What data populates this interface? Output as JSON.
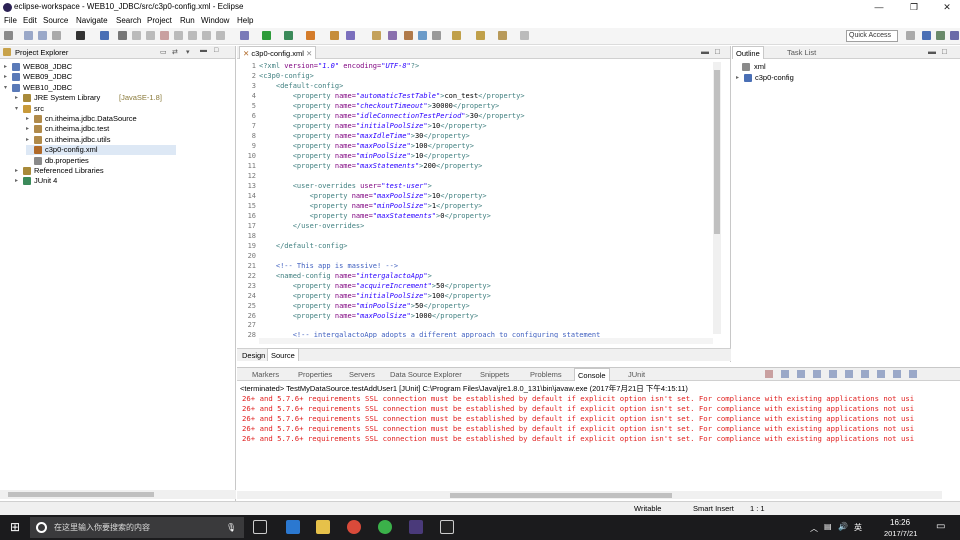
{
  "window": {
    "title": "eclipse-workspace - WEB10_JDBC/src/c3p0-config.xml - Eclipse"
  },
  "menu": [
    "File",
    "Edit",
    "Source",
    "Navigate",
    "Search",
    "Project",
    "Run",
    "Window",
    "Help"
  ],
  "toolbar": {
    "quick_access": "Quick Access"
  },
  "explorer": {
    "title": "Project Explorer",
    "items": [
      {
        "label": "WEB08_JDBC",
        "depth": 0,
        "twisty": "▸"
      },
      {
        "label": "WEB09_JDBC",
        "depth": 0,
        "twisty": "▸"
      },
      {
        "label": "WEB10_JDBC",
        "depth": 0,
        "twisty": "▾"
      },
      {
        "label": "JRE System Library",
        "suffix": "[JavaSE-1.8]",
        "depth": 1,
        "twisty": "▸"
      },
      {
        "label": "src",
        "depth": 1,
        "twisty": "▾"
      },
      {
        "label": "cn.itheima.jdbc.DataSource",
        "depth": 2,
        "twisty": "▸"
      },
      {
        "label": "cn.itheima.jdbc.test",
        "depth": 2,
        "twisty": "▸"
      },
      {
        "label": "cn.itheima.jdbc.utils",
        "depth": 2,
        "twisty": "▸"
      },
      {
        "label": "c3p0-config.xml",
        "depth": 2,
        "twisty": "",
        "selected": true
      },
      {
        "label": "db.properties",
        "depth": 2,
        "twisty": ""
      },
      {
        "label": "Referenced Libraries",
        "depth": 1,
        "twisty": "▸"
      },
      {
        "label": "JUnit 4",
        "depth": 1,
        "twisty": "▸"
      }
    ]
  },
  "editor": {
    "tab": "c3p0-config.xml",
    "bottom_tabs": {
      "design": "Design",
      "source": "Source"
    },
    "line_numbers": [
      "1",
      "2",
      "3",
      "4",
      "5",
      "6",
      "7",
      "8",
      "9",
      "10",
      "11",
      "12",
      "13",
      "14",
      "15",
      "16",
      "17",
      "18",
      "19",
      "20",
      "21",
      "22",
      "23",
      "24",
      "25",
      "26",
      "27",
      "28"
    ],
    "lines": [
      [
        {
          "t": "<?xml ",
          "c": "pi"
        },
        {
          "t": "version=",
          "c": "at"
        },
        {
          "t": "\"1.0\"",
          "c": "av"
        },
        {
          "t": " encoding=",
          "c": "at"
        },
        {
          "t": "\"UTF-8\"",
          "c": "av"
        },
        {
          "t": "?>",
          "c": "pi"
        }
      ],
      [
        {
          "t": "<c3p0-config>",
          "c": "tg"
        }
      ],
      [
        {
          "t": "    <default-config>",
          "c": "tg"
        }
      ],
      [
        {
          "t": "        <property ",
          "c": "tg"
        },
        {
          "t": "name=",
          "c": "at"
        },
        {
          "t": "\"automaticTestTable\"",
          "c": "av"
        },
        {
          "t": ">",
          "c": "tg"
        },
        {
          "t": "con_test",
          "c": "tx"
        },
        {
          "t": "</property>",
          "c": "tg"
        }
      ],
      [
        {
          "t": "        <property ",
          "c": "tg"
        },
        {
          "t": "name=",
          "c": "at"
        },
        {
          "t": "\"checkoutTimeout\"",
          "c": "av"
        },
        {
          "t": ">",
          "c": "tg"
        },
        {
          "t": "30000",
          "c": "tx"
        },
        {
          "t": "</property>",
          "c": "tg"
        }
      ],
      [
        {
          "t": "        <property ",
          "c": "tg"
        },
        {
          "t": "name=",
          "c": "at"
        },
        {
          "t": "\"idleConnectionTestPeriod\"",
          "c": "av"
        },
        {
          "t": ">",
          "c": "tg"
        },
        {
          "t": "30",
          "c": "tx"
        },
        {
          "t": "</property>",
          "c": "tg"
        }
      ],
      [
        {
          "t": "        <property ",
          "c": "tg"
        },
        {
          "t": "name=",
          "c": "at"
        },
        {
          "t": "\"initialPoolSize\"",
          "c": "av"
        },
        {
          "t": ">",
          "c": "tg"
        },
        {
          "t": "10",
          "c": "tx"
        },
        {
          "t": "</property>",
          "c": "tg"
        }
      ],
      [
        {
          "t": "        <property ",
          "c": "tg"
        },
        {
          "t": "name=",
          "c": "at"
        },
        {
          "t": "\"maxIdleTime\"",
          "c": "av"
        },
        {
          "t": ">",
          "c": "tg"
        },
        {
          "t": "30",
          "c": "tx"
        },
        {
          "t": "</property>",
          "c": "tg"
        }
      ],
      [
        {
          "t": "        <property ",
          "c": "tg"
        },
        {
          "t": "name=",
          "c": "at"
        },
        {
          "t": "\"maxPoolSize\"",
          "c": "av"
        },
        {
          "t": ">",
          "c": "tg"
        },
        {
          "t": "100",
          "c": "tx"
        },
        {
          "t": "</property>",
          "c": "tg"
        }
      ],
      [
        {
          "t": "        <property ",
          "c": "tg"
        },
        {
          "t": "name=",
          "c": "at"
        },
        {
          "t": "\"minPoolSize\"",
          "c": "av"
        },
        {
          "t": ">",
          "c": "tg"
        },
        {
          "t": "10",
          "c": "tx"
        },
        {
          "t": "</property>",
          "c": "tg"
        }
      ],
      [
        {
          "t": "        <property ",
          "c": "tg"
        },
        {
          "t": "name=",
          "c": "at"
        },
        {
          "t": "\"maxStatements\"",
          "c": "av"
        },
        {
          "t": ">",
          "c": "tg"
        },
        {
          "t": "200",
          "c": "tx"
        },
        {
          "t": "</property>",
          "c": "tg"
        }
      ],
      [],
      [
        {
          "t": "        <user-overrides ",
          "c": "tg"
        },
        {
          "t": "user=",
          "c": "at"
        },
        {
          "t": "\"test-user\"",
          "c": "av"
        },
        {
          "t": ">",
          "c": "tg"
        }
      ],
      [
        {
          "t": "            <property ",
          "c": "tg"
        },
        {
          "t": "name=",
          "c": "at"
        },
        {
          "t": "\"maxPoolSize\"",
          "c": "av"
        },
        {
          "t": ">",
          "c": "tg"
        },
        {
          "t": "10",
          "c": "tx"
        },
        {
          "t": "</property>",
          "c": "tg"
        }
      ],
      [
        {
          "t": "            <property ",
          "c": "tg"
        },
        {
          "t": "name=",
          "c": "at"
        },
        {
          "t": "\"minPoolSize\"",
          "c": "av"
        },
        {
          "t": ">",
          "c": "tg"
        },
        {
          "t": "1",
          "c": "tx"
        },
        {
          "t": "</property>",
          "c": "tg"
        }
      ],
      [
        {
          "t": "            <property ",
          "c": "tg"
        },
        {
          "t": "name=",
          "c": "at"
        },
        {
          "t": "\"maxStatements\"",
          "c": "av"
        },
        {
          "t": ">",
          "c": "tg"
        },
        {
          "t": "0",
          "c": "tx"
        },
        {
          "t": "</property>",
          "c": "tg"
        }
      ],
      [
        {
          "t": "        </user-overrides>",
          "c": "tg"
        }
      ],
      [],
      [
        {
          "t": "    </default-config>",
          "c": "tg"
        }
      ],
      [],
      [
        {
          "t": "    <!-- This app is massive! -->",
          "c": "cm"
        }
      ],
      [
        {
          "t": "    <named-config ",
          "c": "tg"
        },
        {
          "t": "name=",
          "c": "at"
        },
        {
          "t": "\"intergalactoApp\"",
          "c": "av"
        },
        {
          "t": ">",
          "c": "tg"
        }
      ],
      [
        {
          "t": "        <property ",
          "c": "tg"
        },
        {
          "t": "name=",
          "c": "at"
        },
        {
          "t": "\"acquireIncrement\"",
          "c": "av"
        },
        {
          "t": ">",
          "c": "tg"
        },
        {
          "t": "50",
          "c": "tx"
        },
        {
          "t": "</property>",
          "c": "tg"
        }
      ],
      [
        {
          "t": "        <property ",
          "c": "tg"
        },
        {
          "t": "name=",
          "c": "at"
        },
        {
          "t": "\"initialPoolSize\"",
          "c": "av"
        },
        {
          "t": ">",
          "c": "tg"
        },
        {
          "t": "100",
          "c": "tx"
        },
        {
          "t": "</property>",
          "c": "tg"
        }
      ],
      [
        {
          "t": "        <property ",
          "c": "tg"
        },
        {
          "t": "name=",
          "c": "at"
        },
        {
          "t": "\"minPoolSize\"",
          "c": "av"
        },
        {
          "t": ">",
          "c": "tg"
        },
        {
          "t": "50",
          "c": "tx"
        },
        {
          "t": "</property>",
          "c": "tg"
        }
      ],
      [
        {
          "t": "        <property ",
          "c": "tg"
        },
        {
          "t": "name=",
          "c": "at"
        },
        {
          "t": "\"maxPoolSize\"",
          "c": "av"
        },
        {
          "t": ">",
          "c": "tg"
        },
        {
          "t": "1000",
          "c": "tx"
        },
        {
          "t": "</property>",
          "c": "tg"
        }
      ],
      [],
      [
        {
          "t": "        <!-- intergalactoApp adopts a different approach to configuring statement",
          "c": "cm"
        }
      ]
    ]
  },
  "outline": {
    "tab": "Outline",
    "tab2": "Task List",
    "items": [
      {
        "label": "xml"
      },
      {
        "label": "c3p0-config"
      }
    ]
  },
  "console": {
    "tabs": [
      "Markers",
      "Properties",
      "Servers",
      "Data Source Explorer",
      "Snippets",
      "Problems",
      "Console",
      "JUnit"
    ],
    "active_tab": "Console",
    "header": "<terminated> TestMyDataSource.testAddUser1 [JUnit] C:\\Program Files\\Java\\jre1.8.0_131\\bin\\javaw.exe (2017年7月21日 下午4:15:11)",
    "lines": [
      "26+ and 5.7.6+ requirements SSL connection must be established by default if explicit option isn't set. For compliance with existing applications not usi",
      "26+ and 5.7.6+ requirements SSL connection must be established by default if explicit option isn't set. For compliance with existing applications not usi",
      "26+ and 5.7.6+ requirements SSL connection must be established by default if explicit option isn't set. For compliance with existing applications not usi",
      "26+ and 5.7.6+ requirements SSL connection must be established by default if explicit option isn't set. For compliance with existing applications not usi",
      "26+ and 5.7.6+ requirements SSL connection must be established by default if explicit option isn't set. For compliance with existing applications not usi"
    ]
  },
  "status": {
    "writable": "Writable",
    "insert": "Smart Insert",
    "position": "1 : 1"
  },
  "taskbar": {
    "search_placeholder": "在这里输入你要搜索的内容",
    "time": "16:26",
    "date": "2017/7/21",
    "ime": "英"
  },
  "colors": {
    "accent": "#2c2255",
    "console_error": "#e0201f",
    "taskbar": "#1b1b1d"
  }
}
